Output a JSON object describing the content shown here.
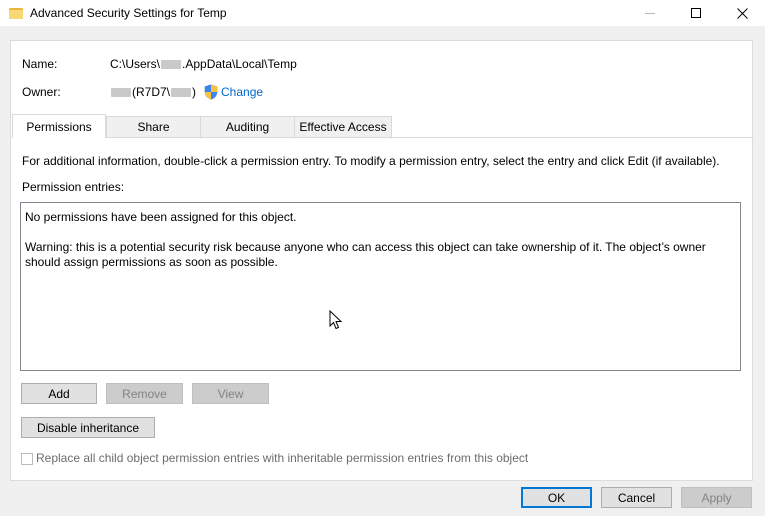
{
  "window": {
    "title": "Advanced Security Settings for Temp",
    "controls": [
      "minimize",
      "maximize",
      "close"
    ]
  },
  "header": {
    "name_label": "Name:",
    "name_value_prefix": "C:\\Users\\",
    "name_value_suffix": ".AppData\\Local\\Temp",
    "owner_label": "Owner:",
    "owner_value_middle": "(R7D7\\",
    "owner_value_end": ")",
    "change_link": "Change"
  },
  "tabs": [
    {
      "label": "Permissions",
      "active": true
    },
    {
      "label": "Share",
      "active": false
    },
    {
      "label": "Auditing",
      "active": false
    },
    {
      "label": "Effective Access",
      "active": false
    }
  ],
  "permissions": {
    "info": "For additional information, double-click a permission entry. To modify a permission entry, select the entry and click Edit (if available).",
    "entries_label": "Permission entries:",
    "empty_message": "No permissions have been assigned for this object.",
    "warning": "Warning: this is a potential security risk because anyone who can access this object can take ownership of it. The object’s owner should assign permissions as soon as possible.",
    "add_label": "Add",
    "remove_label": "Remove",
    "view_label": "View",
    "disable_inheritance_label": "Disable inheritance",
    "replace_checkbox_label": "Replace all child object permission entries with inheritable permission entries from this object",
    "replace_checked": false
  },
  "footer": {
    "ok_label": "OK",
    "cancel_label": "Cancel",
    "apply_label": "Apply"
  },
  "colors": {
    "link": "#0066cc",
    "accent": "#0078d7",
    "disabled_text": "#838383"
  }
}
